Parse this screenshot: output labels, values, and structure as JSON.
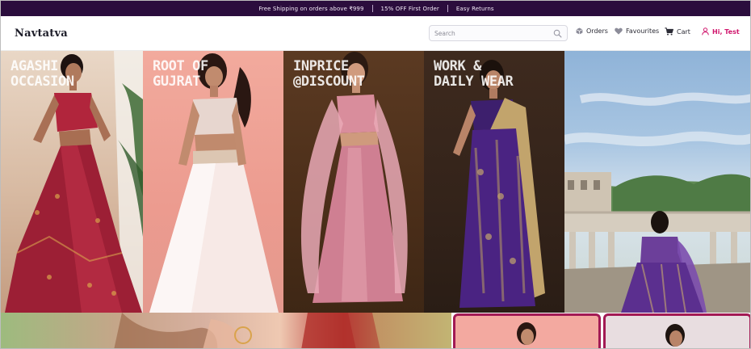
{
  "announcement": {
    "messages": [
      "Free Shipping on orders above ₹999",
      "15% OFF First Order",
      "Easy Returns"
    ]
  },
  "header": {
    "logo": "Navtatva",
    "search": {
      "placeholder": "Search",
      "value": ""
    },
    "nav": {
      "orders": "Orders",
      "favourites": "Favourites",
      "cart": "Cart",
      "user": "Hi, Test"
    }
  },
  "tiles": [
    {
      "line1": "AGASHI",
      "line2": "OCCASION"
    },
    {
      "line1": "ROOT OF",
      "line2": "GUJRAT"
    },
    {
      "line1": "INPRICE",
      "line2": "@DISCOUNT"
    },
    {
      "line1": "WORK &",
      "line2": "DAILY WEAR"
    },
    {
      "line1": "",
      "line2": ""
    }
  ],
  "colors": {
    "announcement_bg": "#2b0d3d",
    "accent": "#d0166d",
    "card_border": "#a21a54"
  },
  "icons": [
    "search-icon",
    "orders-box-icon",
    "heart-icon",
    "cart-icon",
    "user-icon"
  ]
}
